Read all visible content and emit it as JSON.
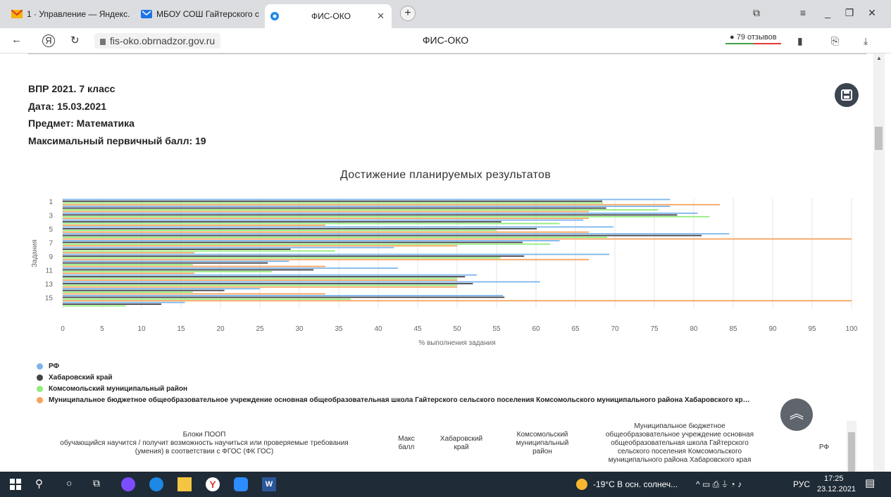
{
  "browser": {
    "tabs": [
      {
        "label": "1 · Управление — Яндекс."
      },
      {
        "label": "МБОУ СОШ Гайтерского с"
      },
      {
        "label": "ФИС-ОКО"
      }
    ],
    "url": "fis-oko.obrnadzor.gov.ru",
    "page_title": "ФИС-ОКО",
    "reviews": "79 отзывов"
  },
  "info": {
    "line1": "ВПР 2021. 7 класс",
    "line2": "Дата: 15.03.2021",
    "line3": "Предмет: Математика",
    "line4": "Максимальный первичный балл: 19"
  },
  "chart_data": {
    "type": "bar",
    "orientation": "horizontal",
    "title": "Достижение планируемых результатов",
    "xlabel": "% выполнения задания",
    "ylabel": "Задания",
    "xlim": [
      0,
      100
    ],
    "xticks": [
      "0",
      "5",
      "10",
      "15",
      "20",
      "25",
      "30",
      "35",
      "40",
      "45",
      "50",
      "55",
      "60",
      "65",
      "70",
      "75",
      "80",
      "85",
      "90",
      "95",
      "100"
    ],
    "ytick_labels": [
      "1",
      "3",
      "5",
      "7",
      "9",
      "11",
      "13",
      "15"
    ],
    "categories": [
      "1",
      "2",
      "3",
      "4",
      "5",
      "6",
      "7",
      "8",
      "9",
      "10",
      "11",
      "12",
      "13",
      "14",
      "15",
      "16"
    ],
    "series": [
      {
        "name": "РФ",
        "color": "#7cb5ec",
        "values": [
          77,
          77,
          80.5,
          66,
          69.8,
          84.5,
          63,
          42,
          69.3,
          28.7,
          42.5,
          52.5,
          60.5,
          25,
          55.8,
          15.5
        ]
      },
      {
        "name": "Хабаровский край",
        "color": "#434348",
        "values": [
          68.4,
          68.9,
          77.9,
          55.6,
          60.1,
          81,
          58.3,
          28.9,
          58.5,
          26,
          31.8,
          51,
          52,
          20.5,
          56,
          12.5
        ]
      },
      {
        "name": "Комсомольский муниципальный район",
        "color": "#90ed7d",
        "values": [
          68.5,
          75.5,
          82,
          63,
          55,
          69,
          61.8,
          34.5,
          55.5,
          16.5,
          26.5,
          50,
          50,
          16.5,
          36.5,
          8
        ]
      },
      {
        "name": "Муниципальное бюджетное общеобразовательное учреждение основная общеобразовательная школа Гайтерского сельского поселения Комсомольского муниципального района Хабаровского кр…",
        "color": "#f7a35c",
        "values": [
          83.3,
          66.7,
          66.7,
          33.3,
          66.7,
          100,
          50,
          16.7,
          66.7,
          33.3,
          16.7,
          50,
          50,
          33.3,
          100,
          0
        ]
      }
    ],
    "legend_position": "bottom-left",
    "grid": true
  },
  "table": {
    "col1": "Блоки ПООП\nобучающийся научится / получит возможность научиться или проверяемые требования\n(умения) в соответствии с ФГОС (ФК ГОС)",
    "col2": "Макс\nбалл",
    "col3": "Хабаровский\nкрай",
    "col4": "Комсомольский\nмуниципальный\nрайон",
    "col5": "Муниципальное бюджетное\nобщеобразовательное учреждение основная\nобщеобразовательная школа Гайтерского\nсельского поселения Комсомольского\nмуниципального района Хабаровского края",
    "col6": "РФ"
  },
  "taskbar": {
    "weather": "-19°C  В осн. солнеч...",
    "lang": "РУС",
    "time": "17:25",
    "date": "23.12.2021"
  },
  "colors": {
    "rf": "#7cb5ec",
    "krai": "#434348",
    "raion": "#90ed7d",
    "school": "#f7a35c"
  }
}
